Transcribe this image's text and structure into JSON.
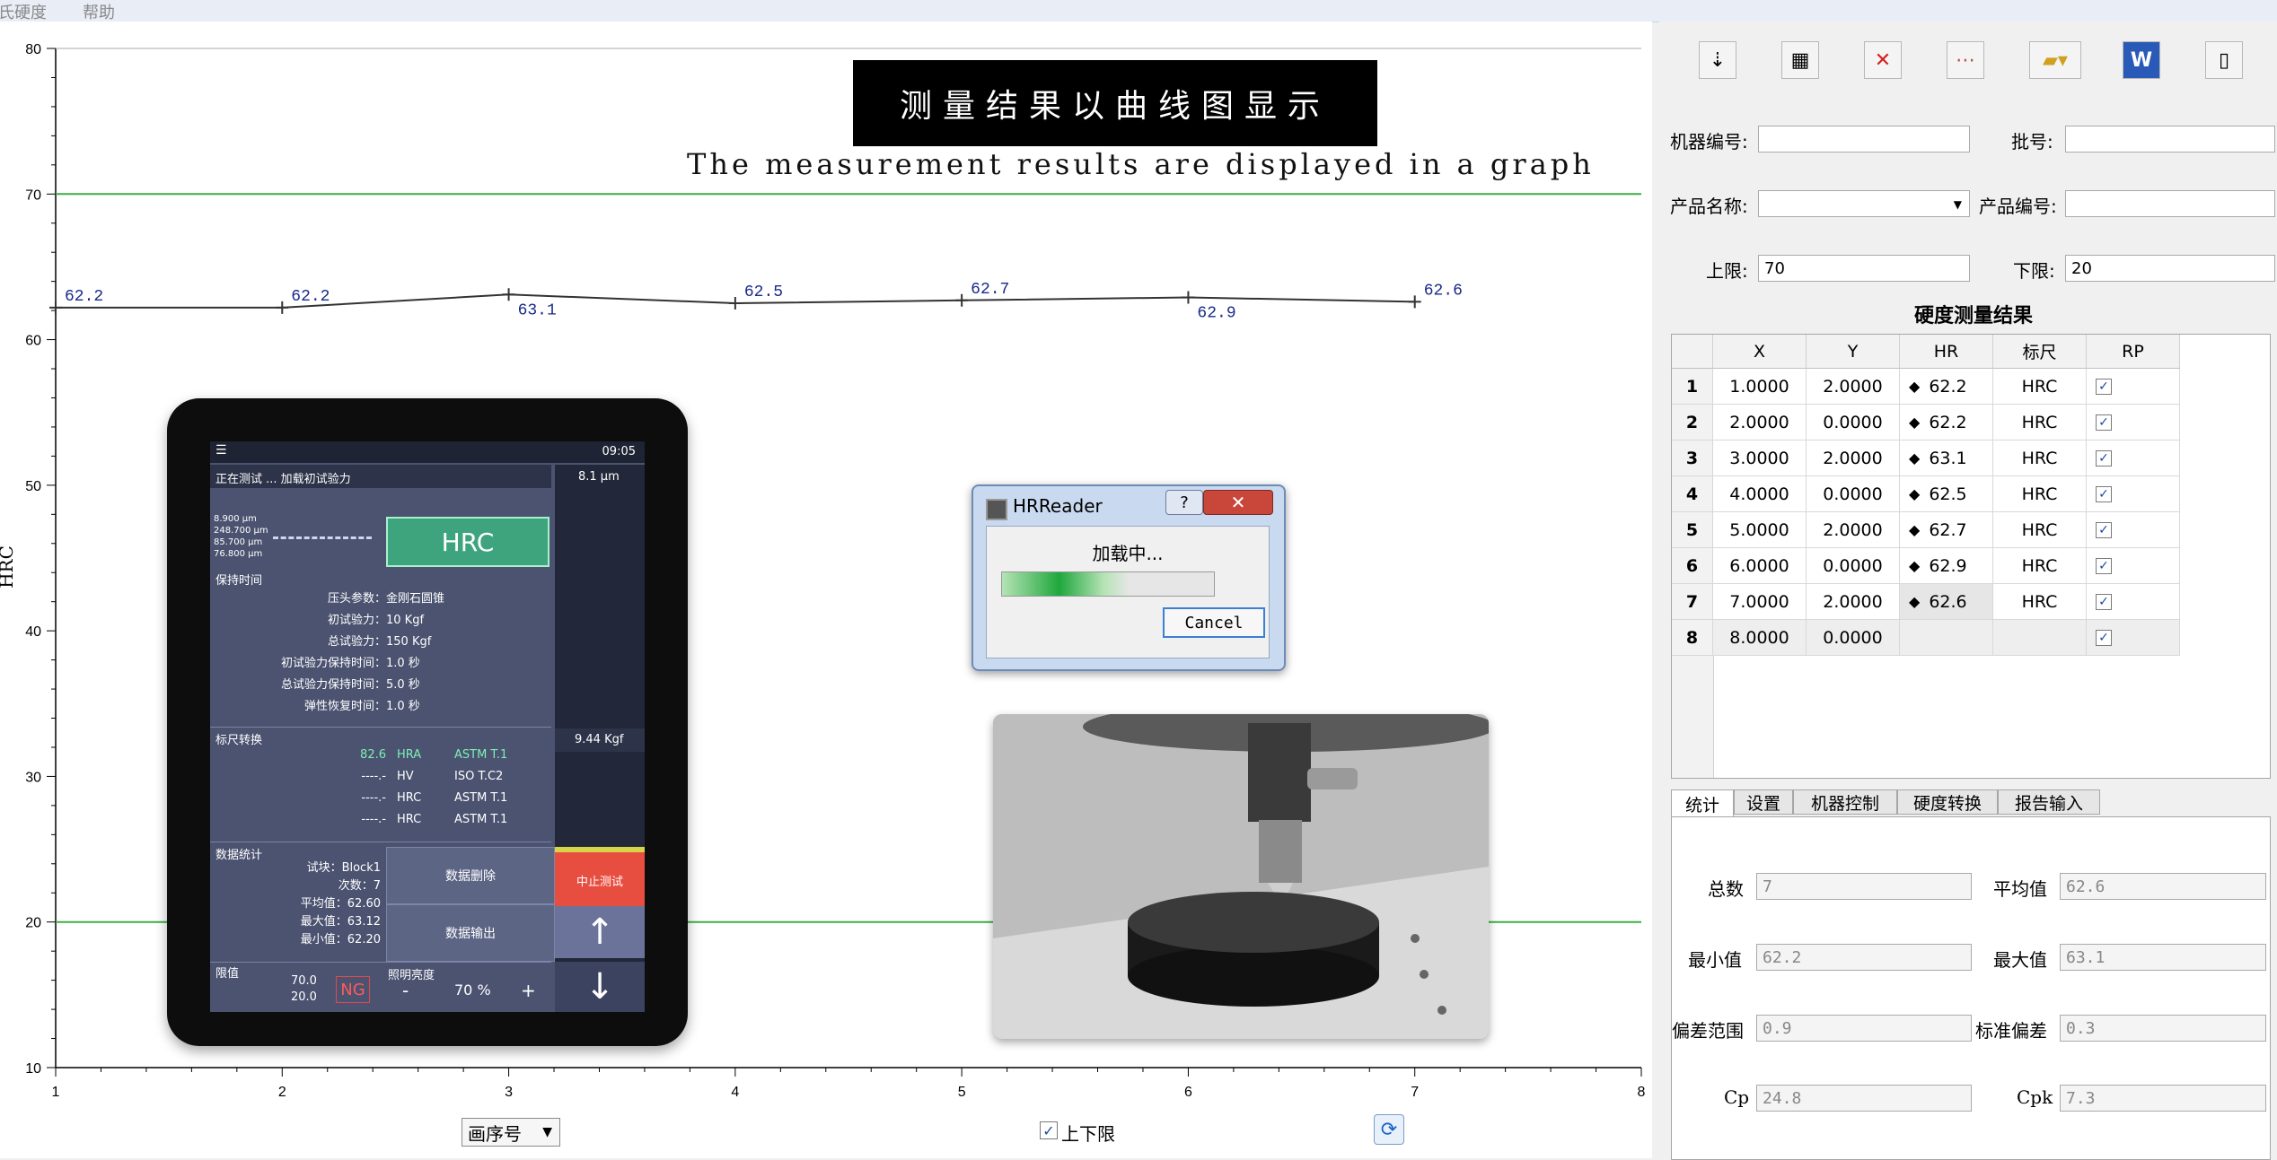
{
  "menu": {
    "items": [
      "里氏硬度",
      "帮助"
    ]
  },
  "overlay": {
    "title": "测量结果以曲线图显示",
    "subtitle": "The measurement results are displayed in a graph"
  },
  "chart_data": {
    "type": "line",
    "ylabel": "HRC",
    "ylim": [
      10,
      80
    ],
    "yticks": [
      10,
      20,
      30,
      40,
      50,
      60,
      70,
      80
    ],
    "xlim": [
      1,
      8
    ],
    "xticks": [
      1,
      2,
      3,
      4,
      5,
      6,
      7,
      8
    ],
    "x": [
      1,
      2,
      3,
      4,
      5,
      6,
      7
    ],
    "values": [
      62.2,
      62.2,
      63.1,
      62.5,
      62.7,
      62.9,
      62.6
    ],
    "upper_limit": 70,
    "lower_limit": 20,
    "colors": {
      "line": "#333333",
      "limit": "#3cb043",
      "label": "#1a2a8a"
    }
  },
  "bottom": {
    "x_combo": "画序号",
    "limits_checkbox": "上下限",
    "limits_checked": true
  },
  "tablet": {
    "time": "09:05",
    "status": "正在测试 ... 加载初试验力",
    "depth": "8.1 μm",
    "readings": [
      "8.900 μm",
      "248.700 μm",
      "85.700 μm",
      "76.800 μm"
    ],
    "hrc": "HRC",
    "hold_title": "保持时间",
    "params": [
      {
        "k": "压头参数：",
        "v": "金刚石圆锥"
      },
      {
        "k": "初试验力：",
        "v": "10 Kgf"
      },
      {
        "k": "总试验力：",
        "v": "150 Kgf"
      },
      {
        "k": "初试验力保持时间：",
        "v": "1.0 秒"
      },
      {
        "k": "总试验力保持时间：",
        "v": "5.0 秒"
      },
      {
        "k": "弹性恢复时间：",
        "v": "1.0 秒"
      }
    ],
    "conv_title": "标尺转换",
    "force": "9.44 Kgf",
    "conversions": [
      {
        "v": "82.6",
        "s": "HRA",
        "std": "ASTM T.1"
      },
      {
        "v": "----.-",
        "s": "HV",
        "std": "ISO T.C2"
      },
      {
        "v": "----.-",
        "s": "HRC",
        "std": "ASTM T.1"
      },
      {
        "v": "----.-",
        "s": "HRC",
        "std": "ASTM T.1"
      }
    ],
    "stats_title": "数据统计",
    "stats": [
      "试块：Block1",
      "次数：7",
      "平均值：62.60",
      "最大值：63.12",
      "最小值：62.20"
    ],
    "btn_delete": "数据删除",
    "btn_export": "数据输出",
    "btn_stop": "中止测试",
    "limit_title": "限值",
    "limit_hi": "70.0",
    "limit_lo": "20.0",
    "ng": "NG",
    "bright_title": "照明亮度",
    "bright_value": "70 %",
    "minus": "-",
    "plus": "+",
    "arrow_up": "↑",
    "arrow_down": "↓"
  },
  "dialog": {
    "title": "HRReader",
    "help": "?",
    "close": "✕",
    "message": "加载中...",
    "progress": 0.6,
    "cancel": "Cancel"
  },
  "right": {
    "toolbar": [
      "probe-icon",
      "grid-icon",
      "delete-icon",
      "chart-icon",
      "open-folder-icon",
      "word-icon",
      "new-file-icon"
    ],
    "machine_label": "机器编号:",
    "machine_value": "",
    "batch_label": "批号:",
    "batch_value": "",
    "product_name_label": "产品名称:",
    "product_name_value": "",
    "product_no_label": "产品编号:",
    "product_no_value": "",
    "upper_label": "上限:",
    "upper_value": "70",
    "lower_label": "下限:",
    "lower_value": "20",
    "result_title": "硬度测量结果",
    "columns": [
      "X",
      "Y",
      "HR",
      "标尺",
      "RP"
    ],
    "rows": [
      {
        "n": "1",
        "x": "1.0000",
        "y": "2.0000",
        "hr": "62.2",
        "scale": "HRC",
        "rp": true
      },
      {
        "n": "2",
        "x": "2.0000",
        "y": "0.0000",
        "hr": "62.2",
        "scale": "HRC",
        "rp": true
      },
      {
        "n": "3",
        "x": "3.0000",
        "y": "2.0000",
        "hr": "63.1",
        "scale": "HRC",
        "rp": true
      },
      {
        "n": "4",
        "x": "4.0000",
        "y": "0.0000",
        "hr": "62.5",
        "scale": "HRC",
        "rp": true
      },
      {
        "n": "5",
        "x": "5.0000",
        "y": "2.0000",
        "hr": "62.7",
        "scale": "HRC",
        "rp": true
      },
      {
        "n": "6",
        "x": "6.0000",
        "y": "0.0000",
        "hr": "62.9",
        "scale": "HRC",
        "rp": true
      },
      {
        "n": "7",
        "x": "7.0000",
        "y": "2.0000",
        "hr": "62.6",
        "scale": "HRC",
        "rp": true
      },
      {
        "n": "8",
        "x": "8.0000",
        "y": "0.0000",
        "hr": "",
        "scale": "",
        "rp": true
      }
    ],
    "tabs": [
      "统计",
      "设置",
      "机器控制",
      "硬度转换",
      "报告输入"
    ],
    "stats": {
      "total_label": "总数",
      "total": "7",
      "avg_label": "平均值",
      "avg": "62.6",
      "min_label": "最小值",
      "min": "62.2",
      "max_label": "最大值",
      "max": "63.1",
      "range_label": "偏差范围",
      "range": "0.9",
      "std_label": "标准偏差",
      "std": "0.3",
      "cp_label": "Cp",
      "cp": "24.8",
      "cpk_label": "Cpk",
      "cpk": "7.3"
    }
  }
}
